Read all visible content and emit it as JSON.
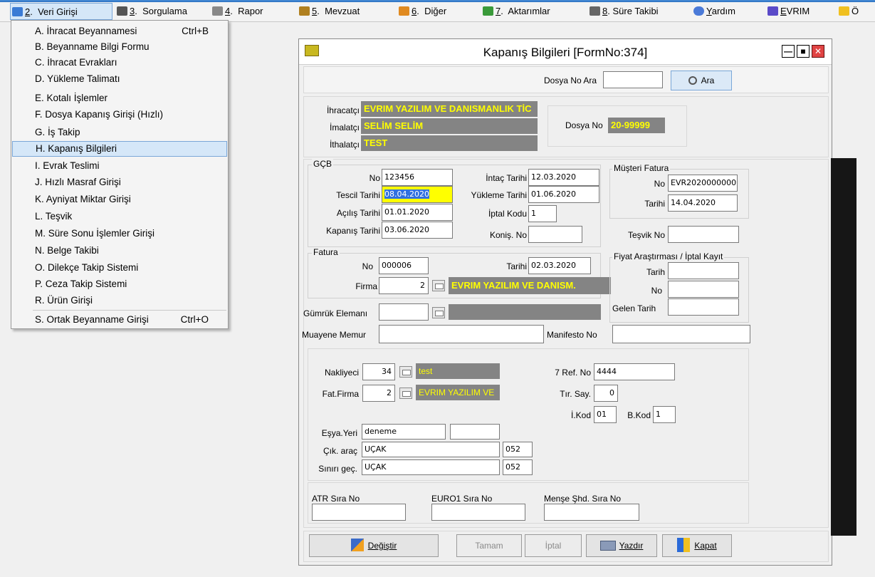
{
  "menubar": {
    "items": [
      {
        "num": "2",
        "label": "Veri Girişi"
      },
      {
        "num": "3",
        "label": "Sorgulama"
      },
      {
        "num": "4",
        "label": "Rapor"
      },
      {
        "num": "5",
        "label": "Mevzuat"
      },
      {
        "num": "6",
        "label": "Diğer"
      },
      {
        "num": "7",
        "label": "Aktarımlar"
      },
      {
        "num": "8",
        "label": "Süre Takibi"
      },
      {
        "num": "Y",
        "label": "ardım"
      },
      {
        "num": "E",
        "label": "VRIM"
      },
      {
        "num": "",
        "label": "Ö"
      }
    ],
    "sep": "."
  },
  "dropdown": {
    "items": [
      {
        "label": "A.  İhracat Beyannamesi",
        "shortcut": "Ctrl+B"
      },
      {
        "label": "B.  Beyanname Bilgi Formu",
        "shortcut": ""
      },
      {
        "label": "C.  İhracat Evrakları",
        "shortcut": ""
      },
      {
        "label": "D.  Yükleme Talimatı",
        "shortcut": ""
      },
      {
        "label": "E.  Kotalı İşlemler",
        "shortcut": ""
      },
      {
        "label": "F.  Dosya Kapanış Girişi (Hızlı)",
        "shortcut": ""
      },
      {
        "label": "G.  İş Takip",
        "shortcut": ""
      },
      {
        "label": "H.  Kapanış Bilgileri",
        "shortcut": ""
      },
      {
        "label": "I.  Evrak Teslimi",
        "shortcut": ""
      },
      {
        "label": "J.  Hızlı Masraf Girişi",
        "shortcut": ""
      },
      {
        "label": "K.  Ayniyat Miktar Girişi",
        "shortcut": ""
      },
      {
        "label": "L.  Teşvik",
        "shortcut": ""
      },
      {
        "label": "M.  Süre Sonu İşlemler Girişi",
        "shortcut": ""
      },
      {
        "label": "N.  Belge Takibi",
        "shortcut": ""
      },
      {
        "label": "O.  Dilekçe Takip Sistemi",
        "shortcut": ""
      },
      {
        "label": "P.  Ceza Takip Sistemi",
        "shortcut": ""
      },
      {
        "label": "R.  Ürün Girişi",
        "shortcut": ""
      },
      {
        "label": "S.  Ortak Beyanname Girişi",
        "shortcut": "Ctrl+O"
      }
    ]
  },
  "window": {
    "title": "Kapanış Bilgileri [FormNo:374]",
    "search": {
      "label": "Dosya No Ara",
      "value": "",
      "button": "Ara"
    },
    "parties": {
      "ihracatci_label": "İhracatçı",
      "ihracatci": "EVRIM YAZILIM VE DANISMANLIK TİC",
      "imalatci_label": "İmalatçı",
      "imalatci": "SELİM SELİM",
      "ithalatci_label": "İthalatçı",
      "ithalatci": "TEST",
      "dosya_no_label": "Dosya No",
      "dosya_no": "20-99999"
    },
    "gcb": {
      "title": "GÇB",
      "no_label": "No",
      "no": "123456",
      "tescil_label": "Tescil Tarihi",
      "tescil": "08.04.2020",
      "acilis_label": "Açılış Tarihi",
      "acilis": "01.01.2020",
      "kapanis_label": "Kapanış Tarihi",
      "kapanis": "03.06.2020",
      "intac_label": "İntaç Tarihi",
      "intac": "12.03.2020",
      "yukleme_label": "Yükleme Tarihi",
      "yukleme": "01.06.2020",
      "iptal_kodu_label": "İptal Kodu",
      "iptal_kodu": "1",
      "konis_label": "Koniş. No",
      "konis": ""
    },
    "musteri": {
      "title": "Müşteri Fatura",
      "no_label": "No",
      "no": "EVR2020000000",
      "tarih_label": "Tarihi",
      "tarih": "14.04.2020"
    },
    "tesvik": {
      "label": "Teşvik No",
      "value": ""
    },
    "fatura": {
      "title": "Fatura",
      "no_label": "No",
      "no": "000006",
      "tarih_label": "Tarihi",
      "tarih": "02.03.2020",
      "firma_label": "Firma",
      "firma_no": "2",
      "firma_name": "EVRIM YAZILIM VE DANISM."
    },
    "fiyat": {
      "title": "Fiyat Araştırması / İptal Kayıt",
      "tarih_label": "Tarih",
      "tarih": "",
      "no_label": "No",
      "no": "",
      "gelen_label": "Gelen Tarih",
      "gelen": ""
    },
    "gumruk": {
      "label": "Gümrük Elemanı",
      "value": "",
      "name": ""
    },
    "muayene": {
      "label": "Muayene Memur",
      "value": ""
    },
    "manifesto": {
      "label": "Manifesto No",
      "value": ""
    },
    "transport": {
      "nakliyeci_label": "Nakliyeci",
      "nakliyeci_no": "34",
      "nakliyeci_name": "test",
      "fatfirma_label": "Fat.Firma",
      "fatfirma_no": "2",
      "fatfirma_name": "EVRIM YAZILIM VE",
      "ref_label": "7 Ref. No",
      "ref": "4444",
      "tir_label": "Tır. Say.",
      "tir": "0",
      "ikod_label": "İ.Kod",
      "ikod": "01",
      "bkod_label": "B.Kod",
      "bkod": "1",
      "esya_label": "Eşya.Yeri",
      "esya": "deneme",
      "esya2": "",
      "cik_label": "Çık. araç",
      "cik": "UÇAK",
      "cik_code": "052",
      "sinir_label": "Sınırı geç.",
      "sinir": "UÇAK",
      "sinir_code": "052"
    },
    "certs": {
      "atr_label": "ATR Sıra No",
      "atr": "",
      "euro_label": "EURO1 Sıra No",
      "euro": "",
      "mense_label": "Menşe Şhd. Sıra No",
      "mense": ""
    },
    "buttons": {
      "degistir": "Değiştir",
      "tamam": "Tamam",
      "iptal": "İptal",
      "yazdir": "Yazdır",
      "kapat": "Kapat"
    }
  }
}
